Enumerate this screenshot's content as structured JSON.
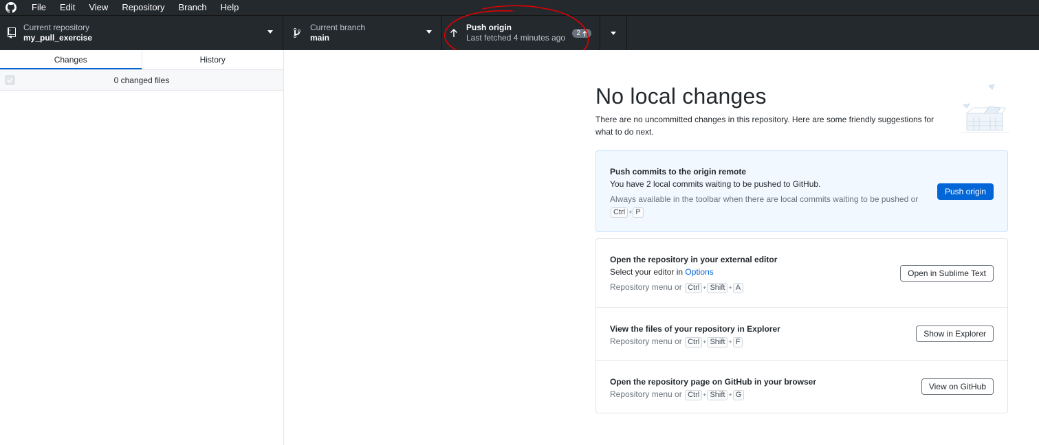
{
  "menu": {
    "items": [
      "File",
      "Edit",
      "View",
      "Repository",
      "Branch",
      "Help"
    ]
  },
  "toolbar": {
    "repo": {
      "description": "Current repository",
      "title": "my_pull_exercise"
    },
    "branch": {
      "description": "Current branch",
      "title": "main"
    },
    "push": {
      "title": "Push origin",
      "description": "Last fetched 4 minutes ago",
      "badge_count": "2"
    }
  },
  "sidebar": {
    "tabs": [
      {
        "label": "Changes",
        "selected": true
      },
      {
        "label": "History",
        "selected": false
      }
    ],
    "changed_files_label": "0 changed files"
  },
  "main": {
    "title": "No local changes",
    "description": "There are no uncommitted changes in this repository. Here are some friendly suggestions for what to do next.",
    "push_card": {
      "title": "Push commits to the origin remote",
      "text": "You have 2 local commits waiting to be pushed to GitHub.",
      "hint": "Always available in the toolbar when there are local commits waiting to be pushed or",
      "shortcut": [
        "Ctrl",
        "P"
      ],
      "button": "Push origin"
    },
    "editor_card": {
      "title": "Open the repository in your external editor",
      "text_prefix": "Select your editor in ",
      "text_link": "Options",
      "hint_prefix": "Repository menu or",
      "shortcut": [
        "Ctrl",
        "Shift",
        "A"
      ],
      "button": "Open in Sublime Text"
    },
    "explorer_card": {
      "title": "View the files of your repository in Explorer",
      "hint_prefix": "Repository menu or",
      "shortcut": [
        "Ctrl",
        "Shift",
        "F"
      ],
      "button": "Show in Explorer"
    },
    "github_card": {
      "title": "Open the repository page on GitHub in your browser",
      "hint_prefix": "Repository menu or",
      "shortcut": [
        "Ctrl",
        "Shift",
        "G"
      ],
      "button": "View on GitHub"
    }
  },
  "colors": {
    "toolbar_bg": "#24292e",
    "accent": "#0366d6",
    "annotation": "#e00000"
  },
  "icons": [
    "github-logo-icon",
    "repo-icon",
    "branch-icon",
    "arrow-up-icon",
    "caret-down-icon",
    "checkbox-icon",
    "no-changes-illustration"
  ]
}
